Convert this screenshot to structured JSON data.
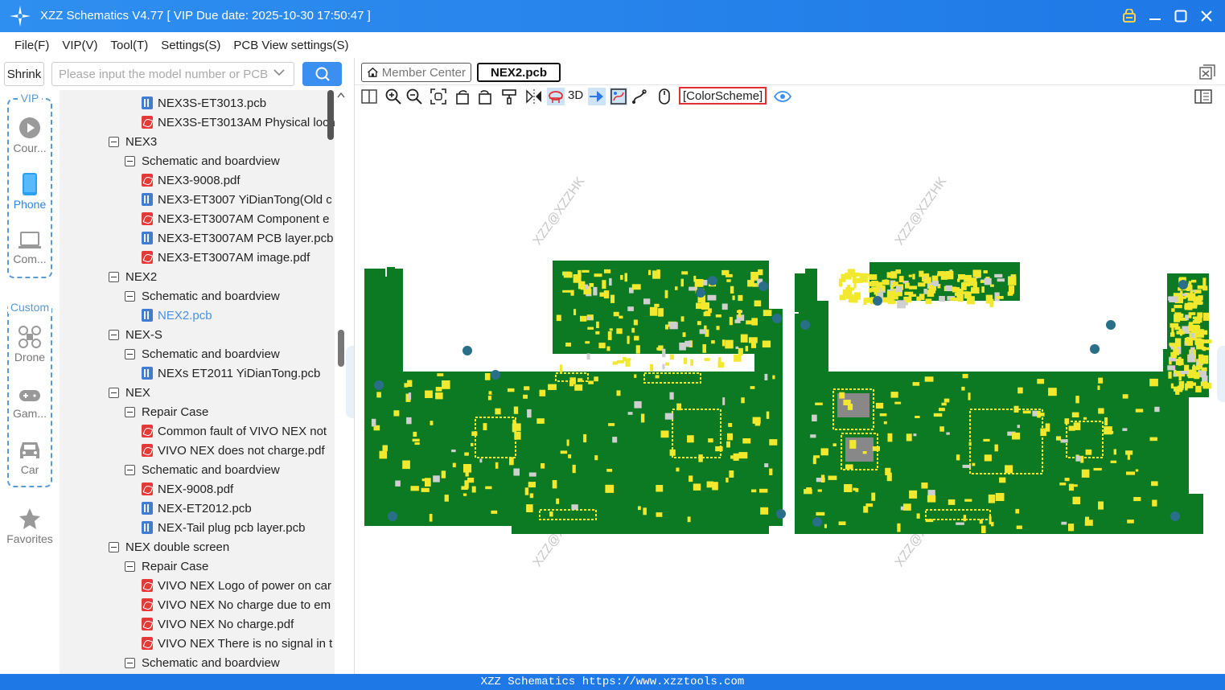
{
  "window": {
    "title": "XZZ Schematics V4.77 [ VIP Due date: 2025-10-30 17:50:47 ]"
  },
  "menu": [
    "File(F)",
    "VIP(V)",
    "Tool(T)",
    "Settings(S)",
    "PCB View settings(S)"
  ],
  "search": {
    "shrink_label": "Shrink",
    "placeholder": "Please input the model number or PCB",
    "value": ""
  },
  "rail": {
    "vip_title": "VIP",
    "custom_title": "Custom",
    "items": [
      {
        "label": "Cour...",
        "icon": "play-circle-icon"
      },
      {
        "label": "Phone",
        "icon": "phone-icon",
        "active": true
      },
      {
        "label": "Com...",
        "icon": "laptop-icon"
      },
      {
        "label": "Drone",
        "icon": "drone-icon"
      },
      {
        "label": "Gam...",
        "icon": "gamepad-icon"
      },
      {
        "label": "Car",
        "icon": "car-icon"
      },
      {
        "label": "Favorites",
        "icon": "star-icon"
      }
    ]
  },
  "tree": [
    {
      "label": "NEX3S-ET3013.pcb",
      "type": "pcb"
    },
    {
      "label": "NEX3S-ET3013AM Physical loca",
      "type": "pdf"
    },
    {
      "label": "NEX3",
      "type": "node"
    },
    {
      "label": "Schematic and boardview",
      "type": "node"
    },
    {
      "label": "NEX3-9008.pdf",
      "type": "pdf"
    },
    {
      "label": "NEX3-ET3007 YiDianTong(Old c",
      "type": "pcb"
    },
    {
      "label": "NEX3-ET3007AM Component e",
      "type": "pdf"
    },
    {
      "label": "NEX3-ET3007AM PCB layer.pcb",
      "type": "pcb"
    },
    {
      "label": "NEX3-ET3007AM image.pdf",
      "type": "pdf"
    },
    {
      "label": "NEX2",
      "type": "node"
    },
    {
      "label": "Schematic and boardview",
      "type": "node"
    },
    {
      "label": "NEX2.pcb",
      "type": "pcb",
      "selected": true
    },
    {
      "label": "NEX-S",
      "type": "node"
    },
    {
      "label": "Schematic and boardview",
      "type": "node"
    },
    {
      "label": "NEXs ET2011 YiDianTong.pcb",
      "type": "pcb"
    },
    {
      "label": "NEX",
      "type": "node"
    },
    {
      "label": "Repair Case",
      "type": "node"
    },
    {
      "label": "Common fault of VIVO NEX not",
      "type": "pdf"
    },
    {
      "label": "VIVO NEX does not charge.pdf",
      "type": "pdf"
    },
    {
      "label": "Schematic and boardview",
      "type": "node"
    },
    {
      "label": "NEX-9008.pdf",
      "type": "pdf"
    },
    {
      "label": "NEX-ET2012.pcb",
      "type": "pcb"
    },
    {
      "label": "NEX-Tail plug pcb layer.pcb",
      "type": "pcb"
    },
    {
      "label": "NEX double screen",
      "type": "node"
    },
    {
      "label": "Repair Case",
      "type": "node"
    },
    {
      "label": "VIVO NEX Logo of power on car",
      "type": "pdf"
    },
    {
      "label": "VIVO NEX No charge due to em",
      "type": "pdf"
    },
    {
      "label": "VIVO NEX No charge.pdf",
      "type": "pdf"
    },
    {
      "label": "VIVO NEX There is no signal in t",
      "type": "pdf"
    },
    {
      "label": "Schematic and boardview",
      "type": "node"
    }
  ],
  "tabs": [
    {
      "label": "Member Center",
      "icon": "home-icon"
    },
    {
      "label": "NEX2.pcb",
      "active": true
    }
  ],
  "toolbar": {
    "label_3d": "3D",
    "color_scheme": "[ColorScheme]",
    "tools": [
      "split-view-icon",
      "zoom-in-icon",
      "zoom-out-icon",
      "fit-screen-icon",
      "rotate-left-icon",
      "rotate-right-icon",
      "paint-brush-icon",
      "mirror-icon",
      "flip-board-icon",
      "3d",
      "pin-icon",
      "net-highlight-icon",
      "trace-icon",
      "mouse-icon",
      "color-scheme",
      "eye-icon"
    ]
  },
  "canvas": {
    "watermark": "XZZ@XZZHK",
    "board_color": "#0b7a22",
    "pad_color": "#f2e92e"
  },
  "statusbar": {
    "text": "XZZ Schematics https://www.xzztools.com"
  },
  "colors": {
    "titlebar": "#2f8ff0",
    "accent": "#3b8ff0",
    "pdf_icon": "#e53a3a",
    "pcb_icon": "#3d7fd6",
    "colorscheme_border": "#e03030"
  }
}
